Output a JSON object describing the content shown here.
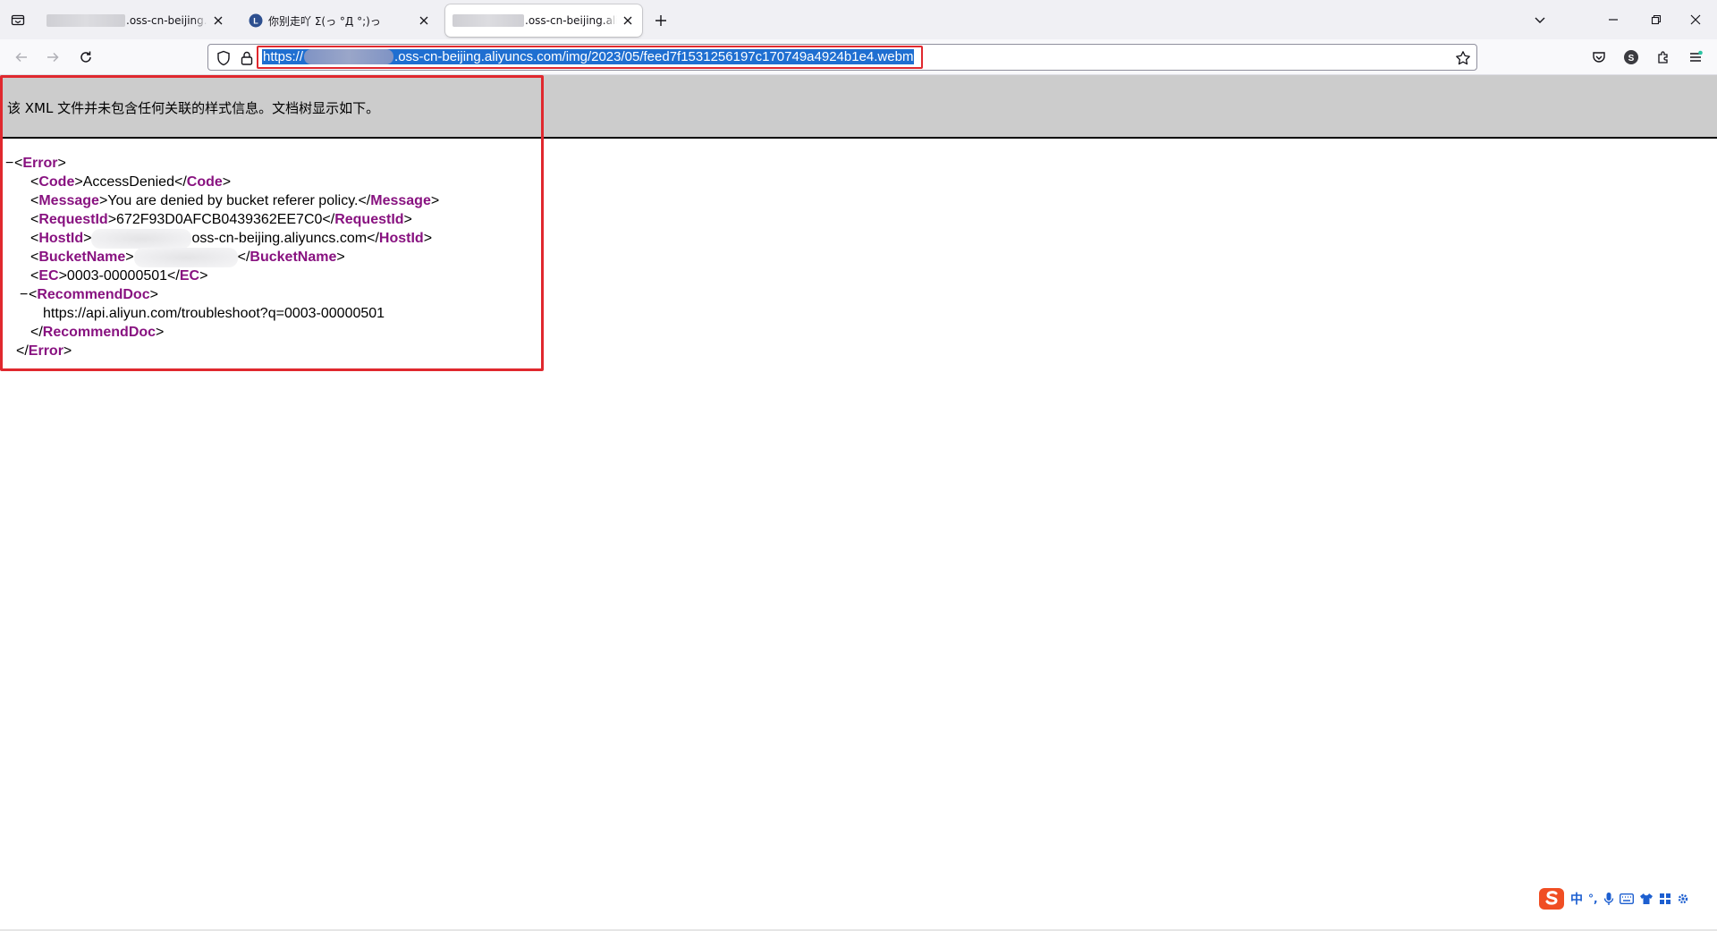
{
  "browser": {
    "tabs": [
      {
        "title_suffix": ".oss-cn-beijing.ali",
        "title_redacted": true,
        "active": false
      },
      {
        "title": "你别走吖 Σ(っ °Д °;)っ",
        "title_redacted": false,
        "active": false
      },
      {
        "title_suffix": ".oss-cn-beijing.ali",
        "title_redacted": true,
        "active": true
      }
    ],
    "url": {
      "prefix": "https://",
      "suffix": ".oss-cn-beijing.aliyuncs.com/img/2023/05/feed7f1531256197c170749a4924b1e4.webm",
      "redacted_part": true
    },
    "icons": {
      "tab_list": "tab-list-icon",
      "new_tab": "plus-icon",
      "list_all_tabs": "chevron-down-icon",
      "minimize": "minimize-icon",
      "restore": "restore-icon",
      "close_window": "close-icon",
      "back": "back-arrow-icon",
      "forward": "forward-arrow-icon",
      "reload": "reload-icon",
      "tracking": "shield-icon",
      "lock": "lock-icon",
      "bookmark": "star-icon",
      "pocket": "pocket-icon",
      "account": "account-icon",
      "extensions": "extensions-icon",
      "menu": "menu-icon"
    },
    "account_initial": "S"
  },
  "xml_viewer": {
    "info_text": "该 XML 文件并未包含任何关联的样式信息。文档树显示如下。",
    "collapse_symbol": "−",
    "lines": {
      "error_open": "Error",
      "code_tag": "Code",
      "code_value": "AccessDenied",
      "message_tag": "Message",
      "message_value": "You are denied by bucket referer policy.",
      "requestid_tag": "RequestId",
      "requestid_value": "672F93D0AFCB0439362EE7C0",
      "hostid_tag": "HostId",
      "hostid_value_suffix": "oss-cn-beijing.aliyuncs.com",
      "bucketname_tag": "BucketName",
      "ec_tag": "EC",
      "ec_value": "0003-00000501",
      "recommenddoc_tag": "RecommendDoc",
      "recommenddoc_value": "https://api.aliyun.com/troubleshoot?q=0003-00000501",
      "error_close": "Error"
    }
  },
  "ime_tray": {
    "mode_label": "中",
    "punct_label": "°,",
    "items": [
      "mic-icon",
      "keyboard-icon",
      "skin-icon",
      "grid-icon",
      "settings-icon"
    ]
  },
  "colors": {
    "xml_tag": "#881280",
    "highlight_red": "#e0282e",
    "url_selection": "#1f6fd1",
    "header_gray": "#cccccc"
  }
}
